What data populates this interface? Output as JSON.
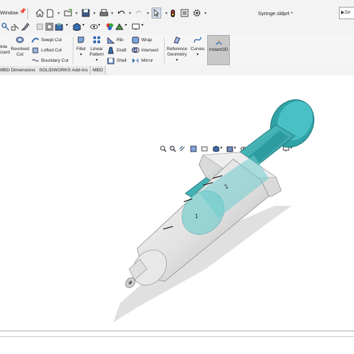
{
  "titlebar": {
    "menu_window": "Window",
    "document_title": "Syringe.sldprt *",
    "search_label": "Se"
  },
  "ribbon": {
    "buttons": {
      "hole_wizard": "Hole\nWizard",
      "revolved_cut": "Revolved\nCut",
      "swept_cut": "Swept Cut",
      "lofted_cut": "Lofted Cut",
      "boundary_cut": "Boundary Cut",
      "fillet": "Fillet",
      "linear_pattern": "Linear\nPattern",
      "rib": "Rib",
      "draft": "Draft",
      "shell": "Shell",
      "wrap": "Wrap",
      "intersect": "Intersect",
      "mirror": "Mirror",
      "reference_geometry": "Reference\nGeometry",
      "curves": "Curves",
      "instant3d": "Instant3D"
    }
  },
  "tabs": [
    {
      "label": "MBD Dimensions"
    },
    {
      "label": "SOLIDWORKS Add-Ins"
    },
    {
      "label": "MBD"
    }
  ],
  "model": {
    "syringe_marks": [
      "1",
      "2"
    ]
  },
  "colors": {
    "plunger": "#2fa3a8",
    "plunger_light": "#5fd0d2",
    "barrel": "#dcdcdc",
    "ribbon_bg": "#f5f5f5",
    "active_button": "#c8c8c8"
  }
}
